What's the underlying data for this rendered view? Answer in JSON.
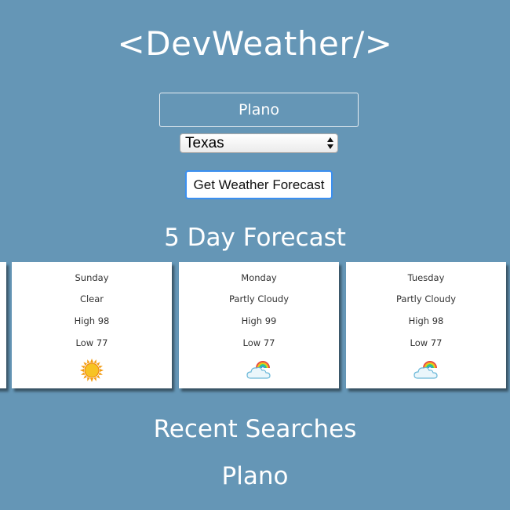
{
  "app": {
    "title": "<DevWeather/>"
  },
  "search": {
    "city_value": "Plano",
    "state_selected": "Texas",
    "button_label": "Get Weather Forecast"
  },
  "forecast": {
    "heading": "5 Day Forecast",
    "days": [
      {
        "day": "Sunday",
        "condition": "Clear",
        "high": "High 98",
        "low": "Low 77",
        "icon": "sun-icon"
      },
      {
        "day": "Monday",
        "condition": "Partly Cloudy",
        "high": "High 99",
        "low": "Low 77",
        "icon": "partly-cloudy-icon"
      },
      {
        "day": "Tuesday",
        "condition": "Partly Cloudy",
        "high": "High 98",
        "low": "Low 77",
        "icon": "partly-cloudy-icon"
      }
    ]
  },
  "recent": {
    "heading": "Recent Searches",
    "items": [
      "Plano"
    ]
  },
  "colors": {
    "background": "#6596b6",
    "card": "#ffffff",
    "button_border": "#3b8ff0"
  }
}
